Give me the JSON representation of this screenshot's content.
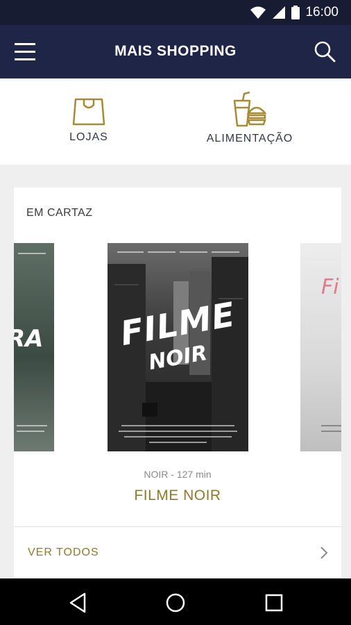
{
  "status_bar": {
    "time": "16:00"
  },
  "app_bar": {
    "title": "MAIS SHOPPING"
  },
  "categories": [
    {
      "label": "LOJAS",
      "icon": "shopping-bag-icon"
    },
    {
      "label": "ALIMENTAÇÃO",
      "icon": "food-drink-icon"
    }
  ],
  "now_showing": {
    "title": "EM CARTAZ",
    "featured": {
      "poster_title_line1": "FILME",
      "poster_title_line2": "NOIR",
      "meta": "NOIR - 127 min",
      "name": "FILME NOIR"
    },
    "left_poster_text": "RA",
    "right_poster_text": "Fi",
    "see_all": "VER TODOS"
  },
  "colors": {
    "app_bar": "#1f2547",
    "status_bar": "#171c33",
    "accent_gold": "#8f7a2c",
    "icon_gold": "#a68b34"
  }
}
